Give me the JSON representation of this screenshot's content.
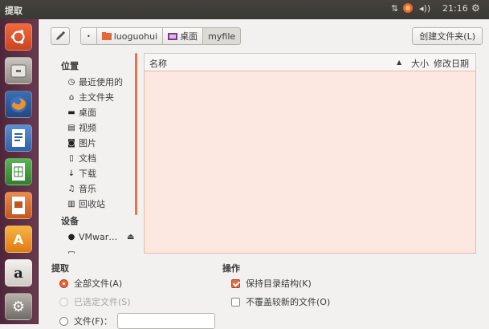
{
  "window": {
    "title": "提取"
  },
  "tray": {
    "time": "21:16",
    "network_icon": "network-updown-icon",
    "update_icon": "update-icon",
    "volume_icon": "volume-icon",
    "settings_icon": "gear-icon"
  },
  "launcher": [
    {
      "name": "ubuntu-dash-icon",
      "color": "#e9502a"
    },
    {
      "name": "file-manager-icon",
      "color": "#8a8580"
    },
    {
      "name": "firefox-icon",
      "color": "#e6711f"
    },
    {
      "name": "libreoffice-writer-icon",
      "color": "#3a7fc4"
    },
    {
      "name": "libreoffice-calc-icon",
      "color": "#3f9a3b"
    },
    {
      "name": "libreoffice-impress-icon",
      "color": "#d9622b"
    },
    {
      "name": "software-center-icon",
      "color": "#f39b1f"
    },
    {
      "name": "amazon-icon",
      "color": "#d9d6d0"
    },
    {
      "name": "system-settings-icon",
      "color": "#9a9590"
    }
  ],
  "path": {
    "crumbs": [
      {
        "label": "luoguohui",
        "icon": "home-folder-icon"
      },
      {
        "label": "桌面",
        "icon": "desktop-folder-icon"
      },
      {
        "label": "myfile"
      }
    ]
  },
  "toolbar": {
    "create_folder_label": "创建文件夹(L)",
    "edit_icon": "pencil-icon",
    "back_icon": "left-arrow-icon"
  },
  "places": {
    "title": "位置",
    "items": [
      {
        "label": "最近使用的",
        "icon": "recent-icon"
      },
      {
        "label": "主文件夹",
        "icon": "home-icon"
      },
      {
        "label": "桌面",
        "icon": "desktop-icon"
      },
      {
        "label": "视频",
        "icon": "video-icon"
      },
      {
        "label": "图片",
        "icon": "camera-icon"
      },
      {
        "label": "文档",
        "icon": "document-icon"
      },
      {
        "label": "下载",
        "icon": "download-icon"
      },
      {
        "label": "音乐",
        "icon": "music-icon"
      },
      {
        "label": "回收站",
        "icon": "trash-icon"
      }
    ],
    "devices_title": "设备",
    "devices": [
      {
        "label": "VMwar…",
        "icon": "disc-icon",
        "eject_icon": "eject-icon"
      }
    ]
  },
  "list": {
    "col_name": "名称",
    "col_size": "大小",
    "col_modified": "修改日期",
    "sort_icon": "sort-ascending-icon"
  },
  "extract": {
    "title": "提取",
    "all_files": "全部文件(A)",
    "selected_files": "已选定文件(S)",
    "files": "文件(F)：",
    "files_value": ""
  },
  "actions": {
    "title": "操作",
    "keep_structure": "保持目录结构(K)",
    "keep_structure_checked": true,
    "no_overwrite": "不覆盖较新的文件(O)",
    "no_overwrite_checked": false
  }
}
